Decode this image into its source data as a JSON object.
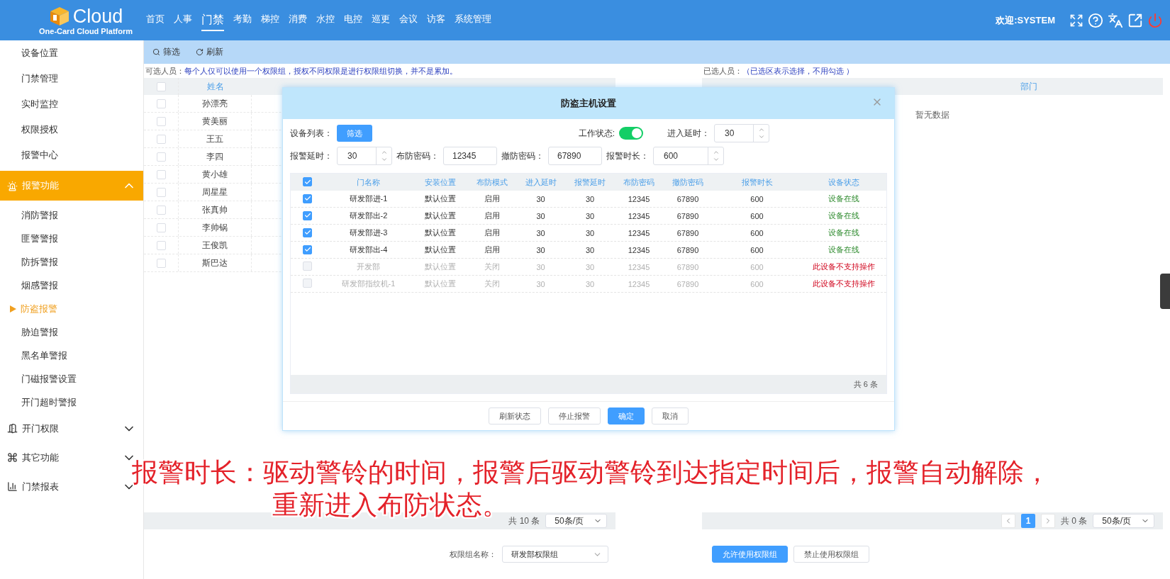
{
  "header": {
    "logo_text": "Cloud",
    "logo_subtitle": "One-Card Cloud Platform",
    "nav": [
      {
        "label": "首页",
        "selected": false
      },
      {
        "label": "人事",
        "selected": false
      },
      {
        "label": "门禁",
        "selected": true
      },
      {
        "label": "考勤",
        "selected": false
      },
      {
        "label": "梯控",
        "selected": false
      },
      {
        "label": "消费",
        "selected": false
      },
      {
        "label": "水控",
        "selected": false
      },
      {
        "label": "电控",
        "selected": false
      },
      {
        "label": "巡更",
        "selected": false
      },
      {
        "label": "会议",
        "selected": false
      },
      {
        "label": "访客",
        "selected": false
      },
      {
        "label": "系统管理",
        "selected": false
      }
    ],
    "welcome": "欢迎:SYSTEM"
  },
  "sidebar": {
    "items": [
      {
        "kind": "item",
        "label": "设备位置"
      },
      {
        "kind": "item",
        "label": "门禁管理"
      },
      {
        "kind": "item",
        "label": "实时监控"
      },
      {
        "kind": "item",
        "label": "权限授权"
      },
      {
        "kind": "item",
        "label": "报警中心"
      },
      {
        "kind": "group",
        "label": "报警功能",
        "expanded": true,
        "children": [
          {
            "label": "消防警报",
            "selected": false
          },
          {
            "label": "匪警警报",
            "selected": false
          },
          {
            "label": "防拆警报",
            "selected": false
          },
          {
            "label": "烟感警报",
            "selected": false
          },
          {
            "label": "防盗报警",
            "selected": true
          },
          {
            "label": "胁迫警报",
            "selected": false
          },
          {
            "label": "黑名单警报",
            "selected": false
          },
          {
            "label": "门磁报警设置",
            "selected": false
          },
          {
            "label": "开门超时警报",
            "selected": false
          }
        ]
      },
      {
        "kind": "group",
        "label": "开门权限",
        "expanded": false
      },
      {
        "kind": "group",
        "label": "其它功能",
        "expanded": false
      },
      {
        "kind": "group",
        "label": "门禁报表",
        "expanded": false
      }
    ]
  },
  "toolbar": [
    {
      "label": "筛选"
    },
    {
      "label": "刷新"
    }
  ],
  "left_panel": {
    "all_checked": false,
    "label": "可选人员：",
    "note": "每个人仅可以使用一个权限组，授权不同权限是进行权限组切换，并不是累加。",
    "columns": [
      "姓名"
    ],
    "rows": [
      {
        "name": "孙漂亮",
        "checked": false
      },
      {
        "name": "黄美丽",
        "checked": false
      },
      {
        "name": "王五",
        "checked": false
      },
      {
        "name": "李四",
        "checked": false
      },
      {
        "name": "黄小雄",
        "checked": false
      },
      {
        "name": "周星星",
        "checked": false
      },
      {
        "name": "张真帅",
        "checked": false
      },
      {
        "name": "李帅锅",
        "checked": false
      },
      {
        "name": "王俊凯",
        "checked": false
      },
      {
        "name": "斯巴达",
        "checked": false
      }
    ],
    "total": "共 10 条",
    "page_size": "50条/页",
    "group_label": "权限组名称：",
    "group_value": "研发部权限组"
  },
  "right_panel": {
    "label": "已选人员：",
    "note": "（已选区表示选择，不用勾选 ）",
    "columns": [
      "部门"
    ],
    "empty_text": "暂无数据",
    "current_page": "1",
    "total": "共 0 条",
    "page_size": "50条/页",
    "buttons": [
      {
        "label": "允许使用权限组",
        "primary": true
      },
      {
        "label": "禁止使用权限组",
        "primary": false
      }
    ]
  },
  "dialog": {
    "title": "防盗主机设置",
    "device_list_label": "设备列表：",
    "filter_button": "筛选",
    "work_state_label": "工作状态:",
    "work_state_on": true,
    "fields": [
      {
        "label": "进入延时：",
        "value": "30",
        "kind": "spinner"
      },
      {
        "label": "报警延时：",
        "value": "30",
        "kind": "spinner"
      },
      {
        "label": "布防密码：",
        "value": "12345",
        "kind": "text"
      },
      {
        "label": "撤防密码：",
        "value": "67890",
        "kind": "text"
      },
      {
        "label": "报警时长：",
        "value": "600",
        "kind": "spinner"
      }
    ],
    "all_checked": true,
    "columns": [
      "门名称",
      "安装位置",
      "布防模式",
      "进入延时",
      "报警延时",
      "布防密码",
      "撤防密码",
      "报警时长",
      "设备状态"
    ],
    "rows": [
      {
        "checked": true,
        "disabled": false,
        "cells": [
          "研发部进-1",
          "默认位置",
          "启用",
          "30",
          "30",
          "12345",
          "67890",
          "600",
          "设备在线"
        ]
      },
      {
        "checked": true,
        "disabled": false,
        "cells": [
          "研发部出-2",
          "默认位置",
          "启用",
          "30",
          "30",
          "12345",
          "67890",
          "600",
          "设备在线"
        ]
      },
      {
        "checked": true,
        "disabled": false,
        "cells": [
          "研发部进-3",
          "默认位置",
          "启用",
          "30",
          "30",
          "12345",
          "67890",
          "600",
          "设备在线"
        ]
      },
      {
        "checked": true,
        "disabled": false,
        "cells": [
          "研发部出-4",
          "默认位置",
          "启用",
          "30",
          "30",
          "12345",
          "67890",
          "600",
          "设备在线"
        ]
      },
      {
        "checked": false,
        "disabled": true,
        "cells": [
          "开发部",
          "默认位置",
          "关闭",
          "30",
          "30",
          "12345",
          "67890",
          "600",
          "此设备不支持操作"
        ]
      },
      {
        "checked": false,
        "disabled": true,
        "cells": [
          "研发部指纹机-1",
          "默认位置",
          "关闭",
          "30",
          "30",
          "12345",
          "67890",
          "600",
          "此设备不支持操作"
        ]
      }
    ],
    "total": "共 6 条",
    "buttons": [
      {
        "label": "刷新状态",
        "primary": false
      },
      {
        "label": "停止报警",
        "primary": false
      },
      {
        "label": "确定",
        "primary": true
      },
      {
        "label": "取消",
        "primary": false
      }
    ]
  },
  "subtitle": {
    "lines": [
      "报警时长：驱动警铃的时间，报警后驱动警铃到达指定时间后，报警自动解除，",
      "重新进入布防状态。"
    ]
  }
}
